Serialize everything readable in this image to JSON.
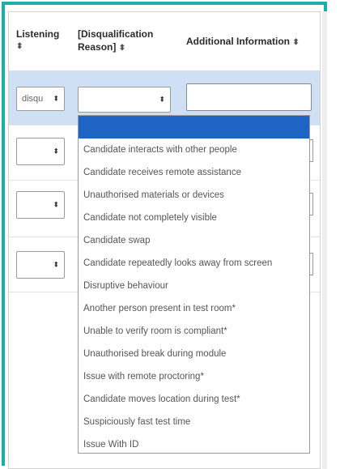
{
  "table": {
    "headers": {
      "listening": "Listening",
      "disqualification_reason": "[Disqualification Reason]",
      "additional_information": "Additional Information"
    },
    "sort_glyph": "⬍",
    "rows": [
      {
        "listening": "disqu"
      },
      {
        "listening": ""
      },
      {
        "listening": ""
      },
      {
        "listening": ""
      }
    ],
    "caret_glyph": "⬍"
  },
  "dropdown": {
    "selected": "",
    "options": [
      "Candidate interacts with other people",
      "Candidate receives remote assistance",
      "Unauthorised materials or devices",
      "Candidate not completely visible",
      "Candidate swap",
      "Candidate repeatedly looks away from screen",
      "Disruptive behaviour",
      "Another person present in test room*",
      "Unable to verify room is compliant*",
      "Unauthorised break during module",
      "Issue with remote proctoring*",
      "Candidate moves location during test*",
      "Suspiciously fast test time",
      "Issue With ID"
    ]
  },
  "colors": {
    "frame_accent": "#1ab0a8",
    "highlight_row": "#cfe0f5",
    "dropdown_selected": "#1d64c4"
  }
}
